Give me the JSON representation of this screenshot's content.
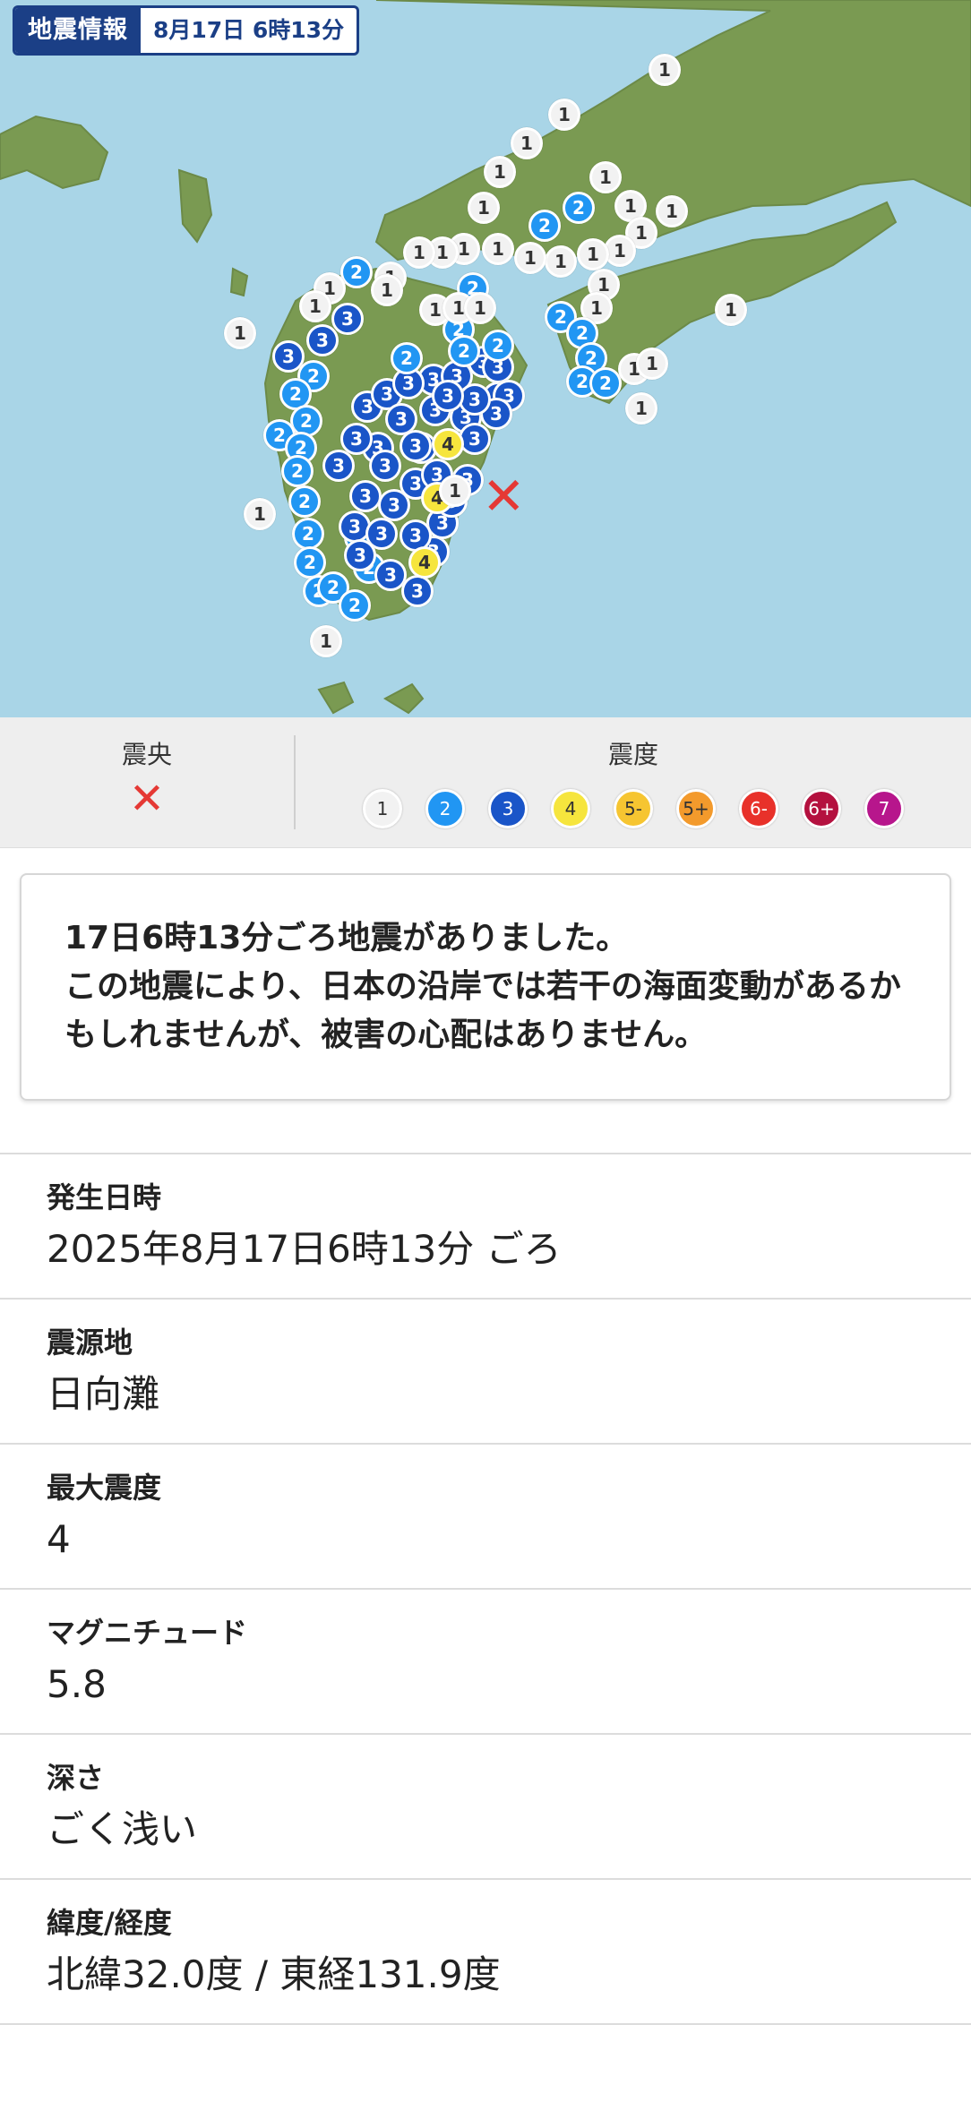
{
  "header": {
    "app_title": "地震情報",
    "datetime": "8月17日 6時13分"
  },
  "map": {
    "colors": {
      "sea": "#a9d5e7",
      "land": "#7a9a52"
    },
    "markers": [
      {
        "v": "1",
        "c": [
          742,
          78
        ]
      },
      {
        "v": "1",
        "c": [
          630,
          128
        ]
      },
      {
        "v": "1",
        "c": [
          588,
          160
        ]
      },
      {
        "v": "1",
        "c": [
          558,
          192
        ]
      },
      {
        "v": "1",
        "c": [
          540,
          232
        ]
      },
      {
        "v": "2",
        "c": [
          608,
          252
        ]
      },
      {
        "v": "2",
        "c": [
          646,
          232
        ]
      },
      {
        "v": "1",
        "c": [
          676,
          198
        ]
      },
      {
        "v": "1",
        "c": [
          704,
          230
        ]
      },
      {
        "v": "1",
        "c": [
          716,
          260
        ]
      },
      {
        "v": "1",
        "c": [
          750,
          236
        ]
      },
      {
        "v": "1",
        "c": [
          692,
          280
        ]
      },
      {
        "v": "1",
        "c": [
          662,
          284
        ]
      },
      {
        "v": "1",
        "c": [
          626,
          292
        ]
      },
      {
        "v": "1",
        "c": [
          592,
          288
        ]
      },
      {
        "v": "1",
        "c": [
          556,
          278
        ]
      },
      {
        "v": "1",
        "c": [
          518,
          278
        ]
      },
      {
        "v": "1",
        "c": [
          494,
          282
        ]
      },
      {
        "v": "1",
        "c": [
          468,
          282
        ]
      },
      {
        "v": "1",
        "c": [
          436,
          310
        ]
      },
      {
        "v": "2",
        "c": [
          398,
          304
        ]
      },
      {
        "v": "2",
        "c": [
          528,
          322
        ]
      },
      {
        "v": "1",
        "c": [
          674,
          318
        ]
      },
      {
        "v": "1",
        "c": [
          666,
          344
        ]
      },
      {
        "v": "2",
        "c": [
          626,
          354
        ]
      },
      {
        "v": "2",
        "c": [
          650,
          372
        ]
      },
      {
        "v": "2",
        "c": [
          660,
          400
        ]
      },
      {
        "v": "2",
        "c": [
          650,
          426
        ]
      },
      {
        "v": "2",
        "c": [
          676,
          428
        ]
      },
      {
        "v": "1",
        "c": [
          708,
          412
        ]
      },
      {
        "v": "1",
        "c": [
          716,
          456
        ]
      },
      {
        "v": "1",
        "c": [
          728,
          406
        ]
      },
      {
        "v": "1",
        "c": [
          816,
          346
        ]
      },
      {
        "v": "1",
        "c": [
          268,
          372
        ]
      },
      {
        "v": "1",
        "c": [
          290,
          574
        ]
      },
      {
        "v": "1",
        "c": [
          364,
          716
        ]
      },
      {
        "v": "1",
        "c": [
          368,
          322
        ]
      },
      {
        "v": "1",
        "c": [
          432,
          324
        ]
      },
      {
        "v": "1",
        "c": [
          352,
          342
        ]
      },
      {
        "v": "3",
        "c": [
          388,
          356
        ]
      },
      {
        "v": "3",
        "c": [
          360,
          380
        ]
      },
      {
        "v": "3",
        "c": [
          322,
          398
        ]
      },
      {
        "v": "2",
        "c": [
          350,
          420
        ]
      },
      {
        "v": "2",
        "c": [
          330,
          440
        ]
      },
      {
        "v": "2",
        "c": [
          342,
          470
        ]
      },
      {
        "v": "2",
        "c": [
          312,
          486
        ]
      },
      {
        "v": "2",
        "c": [
          336,
          500
        ]
      },
      {
        "v": "2",
        "c": [
          332,
          526
        ]
      },
      {
        "v": "2",
        "c": [
          340,
          560
        ]
      },
      {
        "v": "2",
        "c": [
          344,
          596
        ]
      },
      {
        "v": "2",
        "c": [
          346,
          628
        ]
      },
      {
        "v": "2",
        "c": [
          356,
          660
        ]
      },
      {
        "v": "2",
        "c": [
          372,
          656
        ]
      },
      {
        "v": "2",
        "c": [
          396,
          676
        ]
      },
      {
        "v": "2",
        "c": [
          412,
          634
        ]
      },
      {
        "v": "2",
        "c": [
          402,
          600
        ]
      },
      {
        "v": "3",
        "c": [
          410,
          454
        ]
      },
      {
        "v": "3",
        "c": [
          432,
          440
        ]
      },
      {
        "v": "3",
        "c": [
          448,
          468
        ]
      },
      {
        "v": "3",
        "c": [
          422,
          500
        ]
      },
      {
        "v": "3",
        "c": [
          378,
          520
        ]
      },
      {
        "v": "3",
        "c": [
          398,
          490
        ]
      },
      {
        "v": "3",
        "c": [
          430,
          520
        ]
      },
      {
        "v": "3",
        "c": [
          408,
          554
        ]
      },
      {
        "v": "3",
        "c": [
          440,
          564
        ]
      },
      {
        "v": "3",
        "c": [
          396,
          588
        ]
      },
      {
        "v": "3",
        "c": [
          426,
          596
        ]
      },
      {
        "v": "3",
        "c": [
          402,
          620
        ]
      },
      {
        "v": "3",
        "c": [
          436,
          642
        ]
      },
      {
        "v": "3",
        "c": [
          466,
          660
        ]
      },
      {
        "v": "3",
        "c": [
          484,
          616
        ]
      },
      {
        "v": "3",
        "c": [
          494,
          584
        ]
      },
      {
        "v": "3",
        "c": [
          464,
          540
        ]
      },
      {
        "v": "3",
        "c": [
          470,
          500
        ]
      },
      {
        "v": "3",
        "c": [
          486,
          458
        ]
      },
      {
        "v": "3",
        "c": [
          484,
          424
        ]
      },
      {
        "v": "3",
        "c": [
          510,
          420
        ]
      },
      {
        "v": "3",
        "c": [
          520,
          466
        ]
      },
      {
        "v": "3",
        "c": [
          530,
          490
        ]
      },
      {
        "v": "3",
        "c": [
          522,
          536
        ]
      },
      {
        "v": "3",
        "c": [
          504,
          560
        ]
      },
      {
        "v": "3",
        "c": [
          456,
          428
        ]
      },
      {
        "v": "3",
        "c": [
          540,
          404
        ]
      },
      {
        "v": "3",
        "c": [
          556,
          410
        ]
      },
      {
        "v": "3",
        "c": [
          556,
          444
        ]
      },
      {
        "v": "3",
        "c": [
          568,
          442
        ]
      },
      {
        "v": "3",
        "c": [
          554,
          462
        ]
      },
      {
        "v": "3",
        "c": [
          530,
          446
        ]
      },
      {
        "v": "3",
        "c": [
          500,
          442
        ]
      },
      {
        "v": "3",
        "c": [
          464,
          498
        ]
      },
      {
        "v": "3",
        "c": [
          488,
          530
        ]
      },
      {
        "v": "3",
        "c": [
          464,
          598
        ]
      },
      {
        "v": "2",
        "c": [
          454,
          400
        ]
      },
      {
        "v": "2",
        "c": [
          512,
          368
        ]
      },
      {
        "v": "2",
        "c": [
          556,
          386
        ]
      },
      {
        "v": "2",
        "c": [
          518,
          392
        ]
      },
      {
        "v": "1",
        "c": [
          486,
          346
        ]
      },
      {
        "v": "1",
        "c": [
          512,
          344
        ]
      },
      {
        "v": "1",
        "c": [
          536,
          344
        ]
      },
      {
        "v": "4",
        "c": [
          500,
          496
        ]
      },
      {
        "v": "4",
        "c": [
          488,
          556
        ]
      },
      {
        "v": "1",
        "c": [
          508,
          548
        ]
      },
      {
        "v": "4",
        "c": [
          474,
          628
        ]
      }
    ],
    "epicenter": {
      "symbol": "✕"
    }
  },
  "legend": {
    "epicenter_title": "震央",
    "epicenter_symbol": "✕",
    "intensity_title": "震度",
    "scale": [
      {
        "label": "1",
        "bg": "#f2f2f2",
        "fg": "#333333"
      },
      {
        "label": "2",
        "bg": "#2196f3",
        "fg": "#ffffff"
      },
      {
        "label": "3",
        "bg": "#1a55c8",
        "fg": "#ffffff"
      },
      {
        "label": "4",
        "bg": "#f6e53d",
        "fg": "#333333"
      },
      {
        "label": "5-",
        "bg": "#f6c531",
        "fg": "#333333"
      },
      {
        "label": "5+",
        "bg": "#f39a2c",
        "fg": "#333333"
      },
      {
        "label": "6-",
        "bg": "#e8312a",
        "fg": "#ffffff"
      },
      {
        "label": "6+",
        "bg": "#b4113f",
        "fg": "#ffffff"
      },
      {
        "label": "7",
        "bg": "#b7168c",
        "fg": "#ffffff"
      }
    ]
  },
  "notice": {
    "text": "17日6時13分ごろ地震がありました。\nこの地震により、日本の沿岸では若干の海面変動があるかもしれませんが、被害の心配はありません。"
  },
  "details": [
    {
      "label": "発生日時",
      "value": "2025年8月17日6時13分 ごろ"
    },
    {
      "label": "震源地",
      "value": "日向灘"
    },
    {
      "label": "最大震度",
      "value": "4"
    },
    {
      "label": "マグニチュード",
      "value": "5.8"
    },
    {
      "label": "深さ",
      "value": "ごく浅い"
    },
    {
      "label": "緯度/経度",
      "value": "北緯32.0度 / 東経131.9度"
    }
  ]
}
